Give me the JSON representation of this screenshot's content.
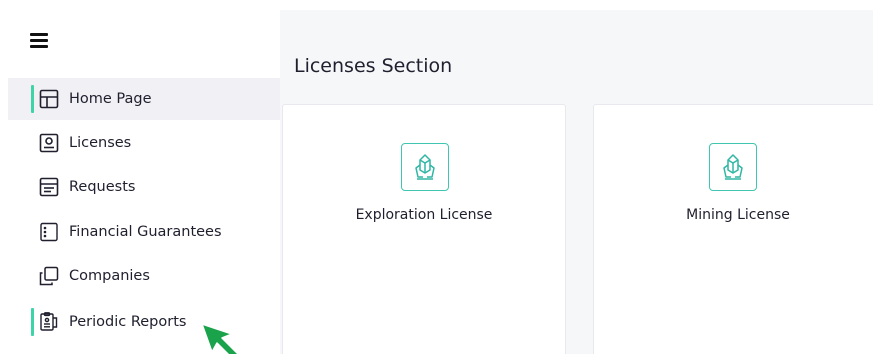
{
  "sidebar": {
    "menu_icon": "hamburger-menu-icon",
    "items": [
      {
        "label": "Home Page",
        "icon": "layout-icon",
        "active": true
      },
      {
        "label": "Licenses",
        "icon": "id-card-icon",
        "active": false
      },
      {
        "label": "Requests",
        "icon": "form-icon",
        "active": false
      },
      {
        "label": "Financial Guarantees",
        "icon": "ledger-icon",
        "active": false
      },
      {
        "label": "Companies",
        "icon": "copy-icon",
        "active": false
      },
      {
        "label": "Periodic Reports",
        "icon": "clipboard-report-icon",
        "active": true
      }
    ]
  },
  "main": {
    "title": "Licenses Section",
    "cards": [
      {
        "label": "Exploration License",
        "icon": "crystal-icon"
      },
      {
        "label": "Mining License",
        "icon": "crystal-icon"
      }
    ]
  },
  "colors": {
    "accent": "#3fd3a8",
    "icon_teal": "#2fb7a3",
    "active_bg": "#f1f0f5",
    "main_bg": "#f6f7f9",
    "cursor": "#1aa34a"
  }
}
